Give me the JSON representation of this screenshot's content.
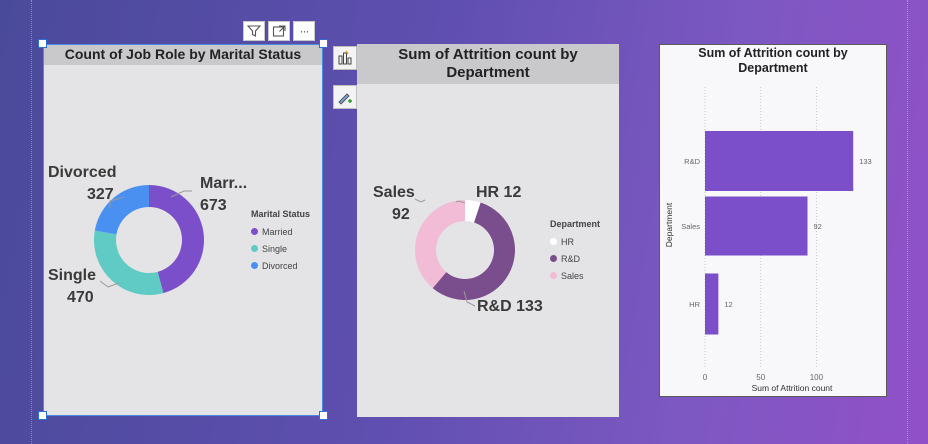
{
  "toolbar": {
    "icons": [
      "filter-icon",
      "focus-mode-icon",
      "more-options-icon"
    ],
    "more_label": "···"
  },
  "side_tools": [
    "build-visual-icon",
    "format-visual-icon"
  ],
  "colors": {
    "married": "#7b4fc9",
    "single": "#5fcbc4",
    "divorced": "#4a90f0",
    "hr": "#ffffff",
    "rd": "#7a4d8c",
    "sales": "#f2bcd6",
    "bar": "#7b4fc9"
  },
  "chart_data": [
    {
      "type": "pie",
      "title": "Count of Job Role by Marital Status",
      "legend_title": "Marital Status",
      "legend_position": "right",
      "categories": [
        "Married",
        "Single",
        "Divorced"
      ],
      "values": [
        673,
        470,
        327
      ],
      "labels": {
        "married_name": "Marr...",
        "married_value": "673",
        "single_name": "Single",
        "single_value": "470",
        "divorced_name": "Divorced",
        "divorced_value": "327"
      }
    },
    {
      "type": "pie",
      "title": "Sum of Attrition count by Department",
      "legend_title": "Department",
      "legend_position": "right",
      "categories": [
        "HR",
        "R&D",
        "Sales"
      ],
      "values": [
        12,
        133,
        92
      ],
      "labels": {
        "hr": "HR 12",
        "rd": "R&D 133",
        "sales_name": "Sales",
        "sales_value": "92"
      }
    },
    {
      "type": "bar",
      "orientation": "horizontal",
      "title": "Sum of Attrition count by Department",
      "xlabel": "Sum of Attrition count",
      "ylabel": "Department",
      "categories": [
        "R&D",
        "Sales",
        "HR"
      ],
      "values": [
        133,
        92,
        12
      ],
      "xlim": [
        0,
        140
      ],
      "xticks": [
        0,
        50,
        100
      ],
      "grid": true
    }
  ]
}
